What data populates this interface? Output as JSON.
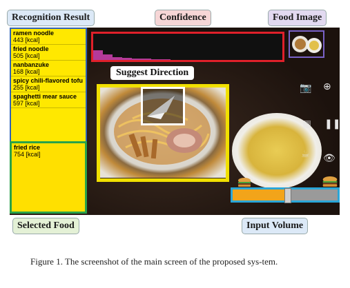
{
  "callouts": {
    "recognition_result": "Recognition Result",
    "confidence": "Confidence",
    "food_image": "Food Image",
    "suggest_direction": "Suggest Direction",
    "selected_food": "Selected Food",
    "input_volume": "Input Volume"
  },
  "recognition_list": [
    {
      "name": "ramen noodle",
      "kcal": "443 [kcal]"
    },
    {
      "name": "fried noodle",
      "kcal": "505 [kcal]"
    },
    {
      "name": "nanbanzuke",
      "kcal": "168 [kcal]"
    },
    {
      "name": "spicy chili-flavored tofu",
      "kcal": "255 [kcal]"
    },
    {
      "name": "spaghetti mear sauce",
      "kcal": "597 [kcal]"
    }
  ],
  "selected_food": {
    "name": "fried rice",
    "kcal": "754 [kcal]"
  },
  "confidence_levels": [
    0.38,
    0.2,
    0.1,
    0.07,
    0.05,
    0.04,
    0.03,
    0.02
  ],
  "input_volume": 0.52,
  "icons": [
    "camera-icon",
    "crosshair-icon",
    "pause-icon",
    "save-icon",
    "eye-icon",
    "cup-icon",
    "burger-small-icon",
    "burger-large-icon",
    "direction-arrow-icon"
  ],
  "colors": {
    "list_bg": "#ffe800",
    "confidence_border": "#e0202a",
    "confidence_bar": "#b43a9a",
    "direction_box": "#f1e000",
    "volume_fill": "#f2a41a",
    "volume_border": "#2aa6d8",
    "selected_border": "#29a24a",
    "list_border": "#2f62b7"
  },
  "caption": "Figure 1. The screenshot of the main screen of the proposed sys-tem."
}
